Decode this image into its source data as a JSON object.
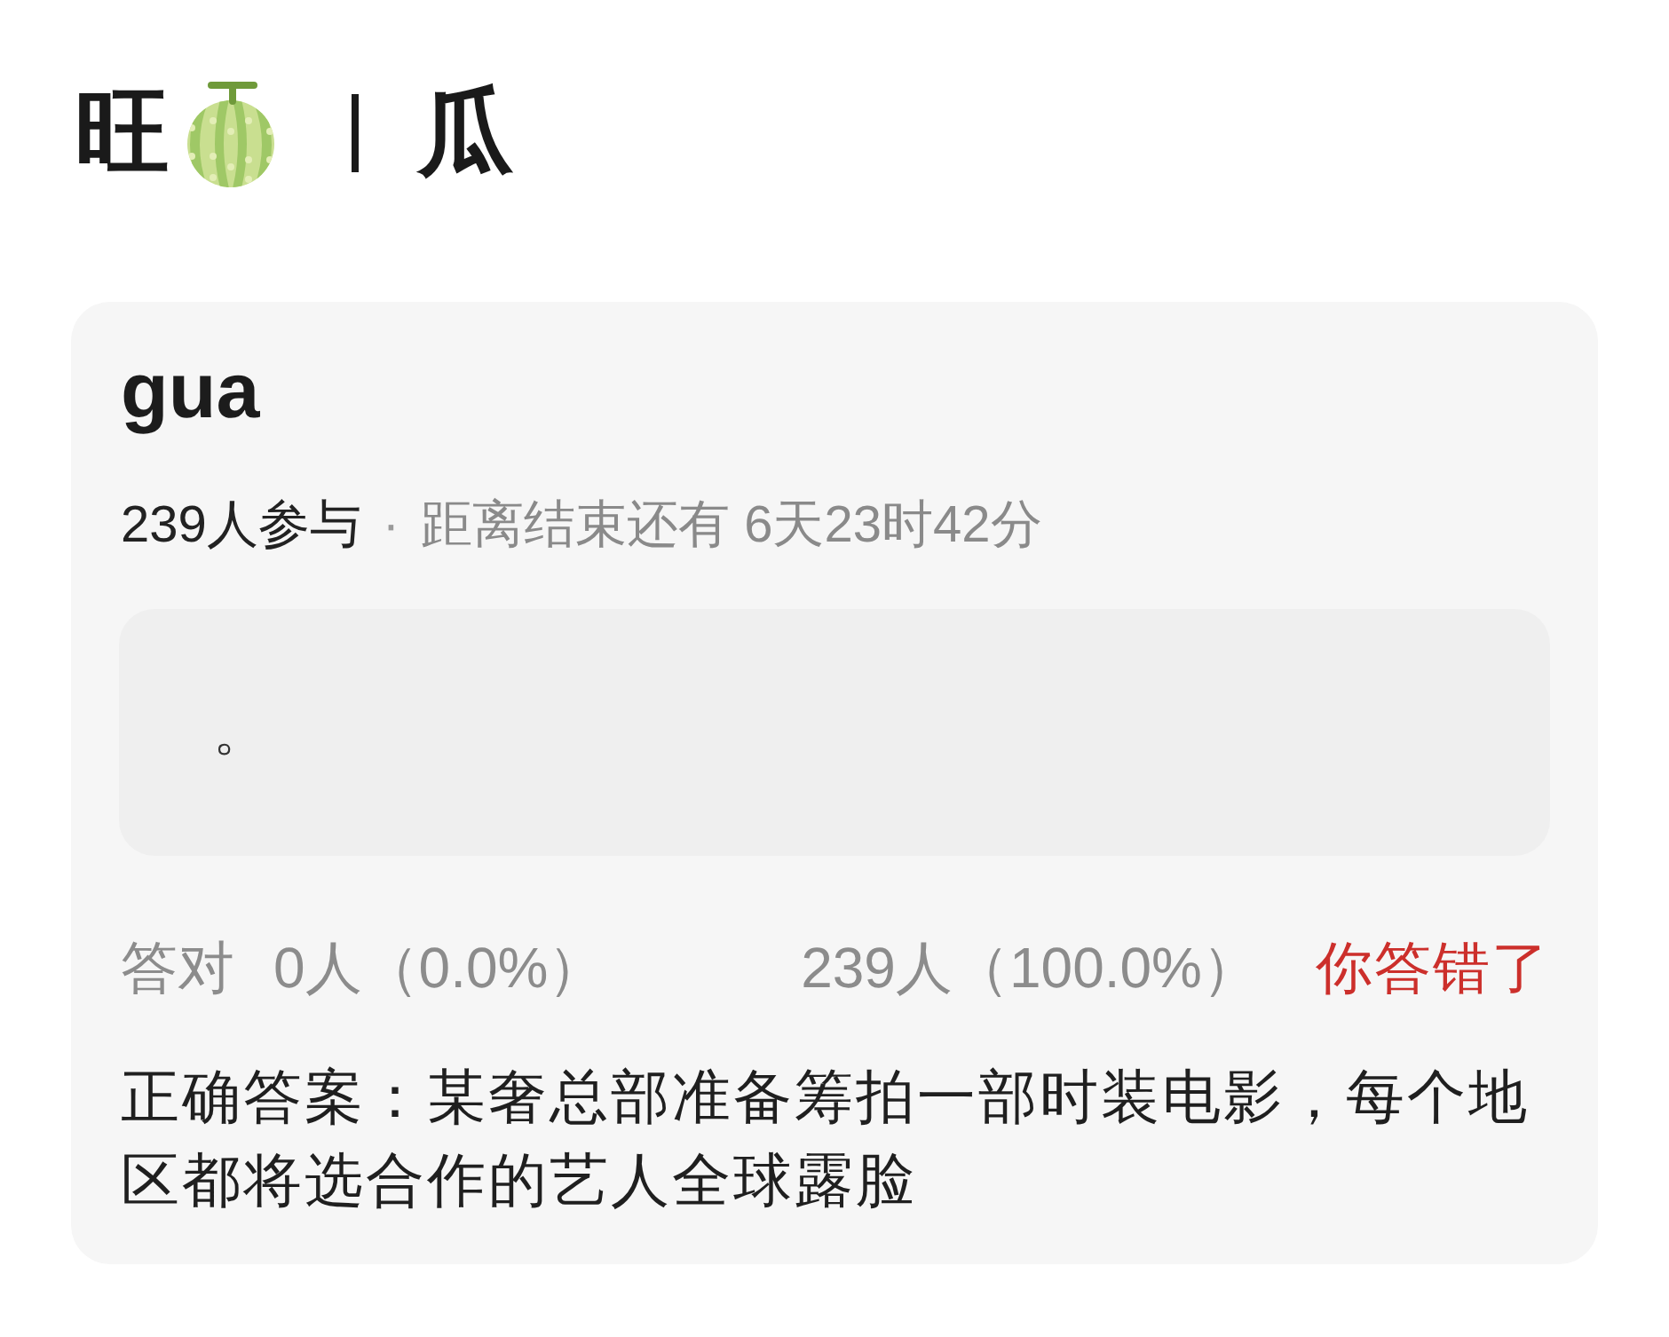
{
  "header": {
    "title_start": "旺",
    "title_end": "瓜"
  },
  "card": {
    "title": "gua",
    "participants": "239人参与",
    "separator": "·",
    "countdown": "距离结束还有 6天23时42分",
    "option": {
      "text": "。"
    },
    "stats": {
      "correct_label": "答对",
      "correct_count": "0人（0.0%）",
      "other_count": "239人（100.0%）"
    },
    "result": {
      "text": "你答错了",
      "correct": false
    },
    "answer": "正确答案：某奢总部准备筹拍一部时装电影，每个地区都将选合作的艺人全球露脸"
  }
}
